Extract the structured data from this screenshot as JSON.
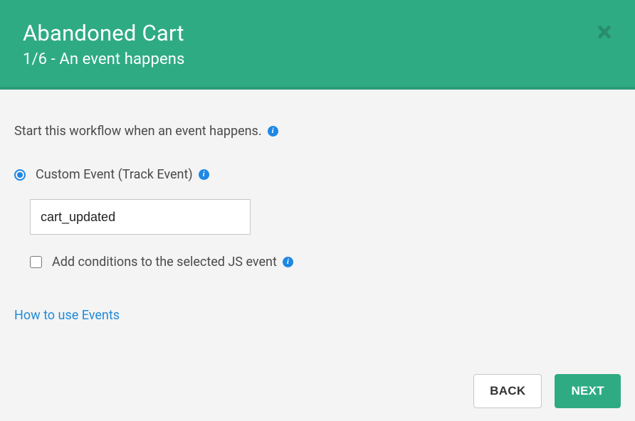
{
  "header": {
    "title": "Abandoned Cart",
    "subtitle": "1/6 - An event happens"
  },
  "body": {
    "intro_text": "Start this workflow when an event happens.",
    "radio_label": "Custom Event (Track Event)",
    "event_value": "cart_updated",
    "checkbox_label": "Add conditions to the selected JS event",
    "help_link": "How to use Events"
  },
  "footer": {
    "back_label": "BACK",
    "next_label": "NEXT"
  }
}
